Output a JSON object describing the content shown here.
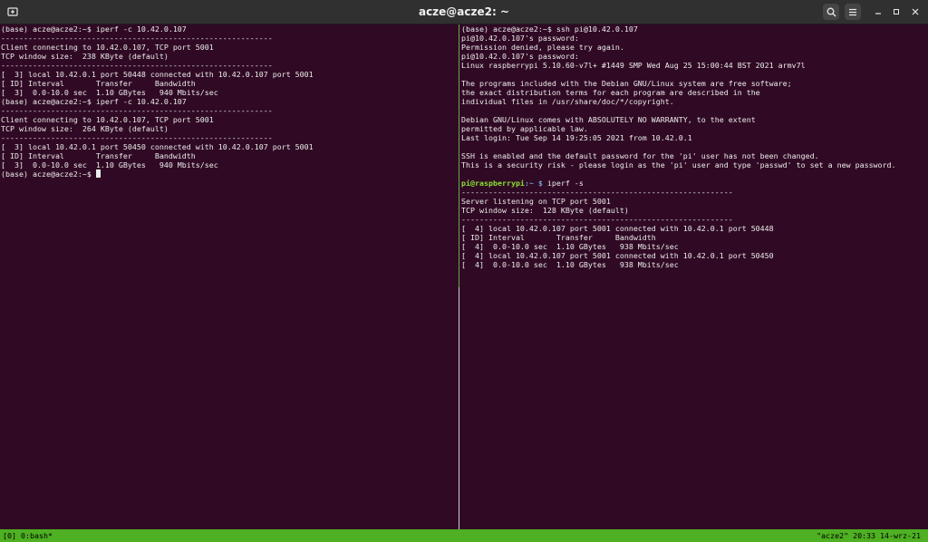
{
  "window": {
    "title": "acze@acze2: ~",
    "icons": {
      "new_tab": "terminal-tab-icon",
      "search": "search-icon",
      "menu": "hamburger-menu-icon",
      "minimize": "minimize-icon",
      "maximize": "maximize-icon",
      "close": "close-icon"
    }
  },
  "colors": {
    "background": "#300a24",
    "text": "#ececec",
    "prompt_user": "#8ae234",
    "prompt_path": "#729fcf",
    "statusbar": "#4eb022"
  },
  "left_pane": {
    "lines": [
      "(base) acze@acze2:~$ iperf -c 10.42.0.107",
      "------------------------------------------------------------",
      "Client connecting to 10.42.0.107, TCP port 5001",
      "TCP window size:  238 KByte (default)",
      "------------------------------------------------------------",
      "[  3] local 10.42.0.1 port 50448 connected with 10.42.0.107 port 5001",
      "[ ID] Interval       Transfer     Bandwidth",
      "[  3]  0.0-10.0 sec  1.10 GBytes   940 Mbits/sec",
      "(base) acze@acze2:~$ iperf -c 10.42.0.107",
      "------------------------------------------------------------",
      "Client connecting to 10.42.0.107, TCP port 5001",
      "TCP window size:  264 KByte (default)",
      "------------------------------------------------------------",
      "[  3] local 10.42.0.1 port 50450 connected with 10.42.0.107 port 5001",
      "[ ID] Interval       Transfer     Bandwidth",
      "[  3]  0.0-10.0 sec  1.10 GBytes   940 Mbits/sec"
    ],
    "prompt": "(base) acze@acze2:~$ "
  },
  "right_pane": {
    "lines_before_prompt": [
      "(base) acze@acze2:~$ ssh pi@10.42.0.107",
      "pi@10.42.0.107's password:",
      "Permission denied, please try again.",
      "pi@10.42.0.107's password:",
      "Linux raspberrypi 5.10.60-v7l+ #1449 SMP Wed Aug 25 15:00:44 BST 2021 armv7l",
      "",
      "The programs included with the Debian GNU/Linux system are free software;",
      "the exact distribution terms for each program are described in the",
      "individual files in /usr/share/doc/*/copyright.",
      "",
      "Debian GNU/Linux comes with ABSOLUTELY NO WARRANTY, to the extent",
      "permitted by applicable law.",
      "Last login: Tue Sep 14 19:25:05 2021 from 10.42.0.1",
      "",
      "SSH is enabled and the default password for the 'pi' user has not been changed.",
      "This is a security risk - please login as the 'pi' user and type 'passwd' to set a new password.",
      ""
    ],
    "pi_prompt": {
      "user_host": "pi@raspberrypi",
      "path": ":~ $",
      "command": " iperf -s"
    },
    "lines_after_prompt": [
      "------------------------------------------------------------",
      "Server listening on TCP port 5001",
      "TCP window size:  128 KByte (default)",
      "------------------------------------------------------------",
      "[  4] local 10.42.0.107 port 5001 connected with 10.42.0.1 port 50448",
      "[ ID] Interval       Transfer     Bandwidth",
      "[  4]  0.0-10.0 sec  1.10 GBytes   938 Mbits/sec",
      "[  4] local 10.42.0.107 port 5001 connected with 10.42.0.1 port 50450",
      "[  4]  0.0-10.0 sec  1.10 GBytes   938 Mbits/sec"
    ]
  },
  "statusbar": {
    "left": "[0] 0:bash*",
    "right": "\"acze2\" 20:33 14-wrz-21"
  }
}
